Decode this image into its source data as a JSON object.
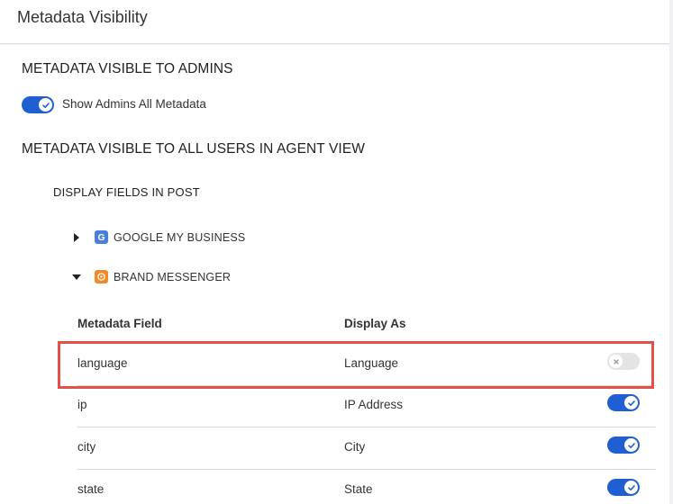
{
  "header": {
    "title": "Metadata Visibility"
  },
  "admins": {
    "section_title": "METADATA VISIBLE TO ADMINS",
    "toggle_label": "Show Admins All Metadata",
    "toggle_on": true
  },
  "agent_view": {
    "section_title": "METADATA VISIBLE TO ALL USERS IN AGENT VIEW",
    "display_fields_title": "DISPLAY FIELDS IN POST",
    "channels": [
      {
        "label": "GOOGLE MY BUSINESS",
        "expanded": false,
        "icon": "google-icon"
      },
      {
        "label": "BRAND MESSENGER",
        "expanded": true,
        "icon": "messenger-icon"
      }
    ]
  },
  "table": {
    "headers": {
      "field": "Metadata Field",
      "display": "Display As"
    },
    "rows": [
      {
        "field": "language",
        "display": "Language",
        "visible": false
      },
      {
        "field": "ip",
        "display": "IP Address",
        "visible": true
      },
      {
        "field": "city",
        "display": "City",
        "visible": true
      },
      {
        "field": "state",
        "display": "State",
        "visible": true
      }
    ]
  },
  "colors": {
    "accent": "#1f5fd1",
    "highlight": "#e0514a"
  }
}
